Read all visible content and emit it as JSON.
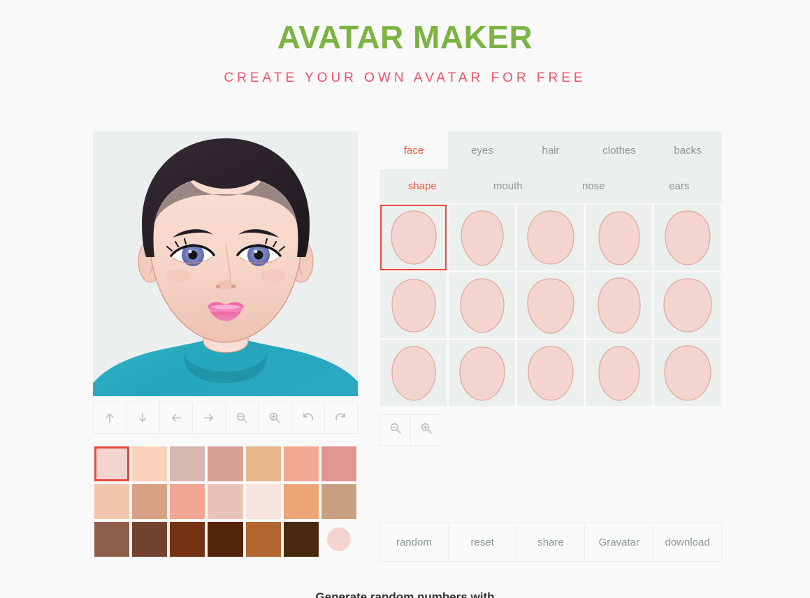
{
  "header": {
    "title": "AVATAR MAKER",
    "subtitle": "CREATE YOUR OWN AVATAR FOR FREE",
    "title_color": "#7cb342",
    "subtitle_color": "#ef5266"
  },
  "avatar": {
    "canvas_bg": "#ebf0ef",
    "skin": "#f6d6ca",
    "skin_shadow": "#edbfb1",
    "skin_light": "#fae2d8",
    "hair": "#2a2028",
    "hair_highlight": "#3a3038",
    "eye_iris": "#7d85c4",
    "eye_iris_dark": "#5d66a8",
    "eye_pupil": "#151515",
    "eye_white": "#ffffff",
    "lash": "#1b1b1b",
    "brow": "#241b22",
    "lips": "#f06ba8",
    "lips_light": "#f9a8cd",
    "shirt": "#2ba9c0",
    "shirt_dark": "#1d8a9e",
    "outline": "#d9998a"
  },
  "toolbar": {
    "buttons": [
      {
        "name": "move-up",
        "icon": "arrow-up-icon"
      },
      {
        "name": "move-down",
        "icon": "arrow-down-icon"
      },
      {
        "name": "move-left",
        "icon": "arrow-left-icon"
      },
      {
        "name": "move-right",
        "icon": "arrow-right-icon"
      },
      {
        "name": "zoom-out",
        "icon": "zoom-out-icon"
      },
      {
        "name": "zoom-in",
        "icon": "zoom-in-icon"
      },
      {
        "name": "undo",
        "icon": "undo-icon"
      },
      {
        "name": "redo",
        "icon": "redo-icon"
      }
    ]
  },
  "palette": {
    "selected_index": 0,
    "current_color": "#f4d4ce",
    "colors": [
      "#f4d4ce",
      "#fbd1bb",
      "#d7b8b1",
      "#d7a296",
      "#e8b78e",
      "#f3a991",
      "#e09792",
      "#f0c5ab",
      "#d9a183",
      "#f0a691",
      "#eac3b8",
      "#f7e3e0",
      "#eda477",
      "#caa082",
      "#8f5f4c",
      "#74432f",
      "#743312",
      "#532409",
      "#b1672f",
      "#49290f"
    ]
  },
  "tabs": {
    "active": "face",
    "items": [
      {
        "id": "face",
        "label": "face"
      },
      {
        "id": "eyes",
        "label": "eyes"
      },
      {
        "id": "hair",
        "label": "hair"
      },
      {
        "id": "clothes",
        "label": "clothes"
      },
      {
        "id": "backs",
        "label": "backs"
      }
    ]
  },
  "subtabs": {
    "active": "shape",
    "items": [
      {
        "id": "shape",
        "label": "shape"
      },
      {
        "id": "mouth",
        "label": "mouth"
      },
      {
        "id": "nose",
        "label": "nose"
      },
      {
        "id": "ears",
        "label": "ears"
      }
    ]
  },
  "shape_grid": {
    "selected_index": 0,
    "count": 15,
    "tile_bg": "#ebf0ef",
    "shape_fill": "#f4d4ce",
    "shape_stroke": "#dda99d",
    "shapes": [
      {
        "index": 0,
        "variant": "oval-wide"
      },
      {
        "index": 1,
        "variant": "oval-pointed"
      },
      {
        "index": 2,
        "variant": "oval-round"
      },
      {
        "index": 3,
        "variant": "oval-narrow"
      },
      {
        "index": 4,
        "variant": "oval-soft"
      },
      {
        "index": 5,
        "variant": "oval-square"
      },
      {
        "index": 6,
        "variant": "oval-tapered"
      },
      {
        "index": 7,
        "variant": "oval-heart"
      },
      {
        "index": 8,
        "variant": "oval-long"
      },
      {
        "index": 9,
        "variant": "oval-broad"
      },
      {
        "index": 10,
        "variant": "oval-diamond"
      },
      {
        "index": 11,
        "variant": "oval-angular"
      },
      {
        "index": 12,
        "variant": "oval-egg"
      },
      {
        "index": 13,
        "variant": "oval-slim"
      },
      {
        "index": 14,
        "variant": "oval-full"
      }
    ]
  },
  "grid_zoom": {
    "buttons": [
      {
        "name": "grid-zoom-out",
        "icon": "zoom-out-icon"
      },
      {
        "name": "grid-zoom-in",
        "icon": "zoom-in-icon"
      }
    ]
  },
  "actions": {
    "buttons": [
      {
        "id": "random",
        "label": "random"
      },
      {
        "id": "reset",
        "label": "reset"
      },
      {
        "id": "share",
        "label": "share"
      },
      {
        "id": "gravatar",
        "label": "Gravatar"
      },
      {
        "id": "download",
        "label": "download"
      }
    ]
  },
  "footer": {
    "note": "Generate random numbers with"
  }
}
